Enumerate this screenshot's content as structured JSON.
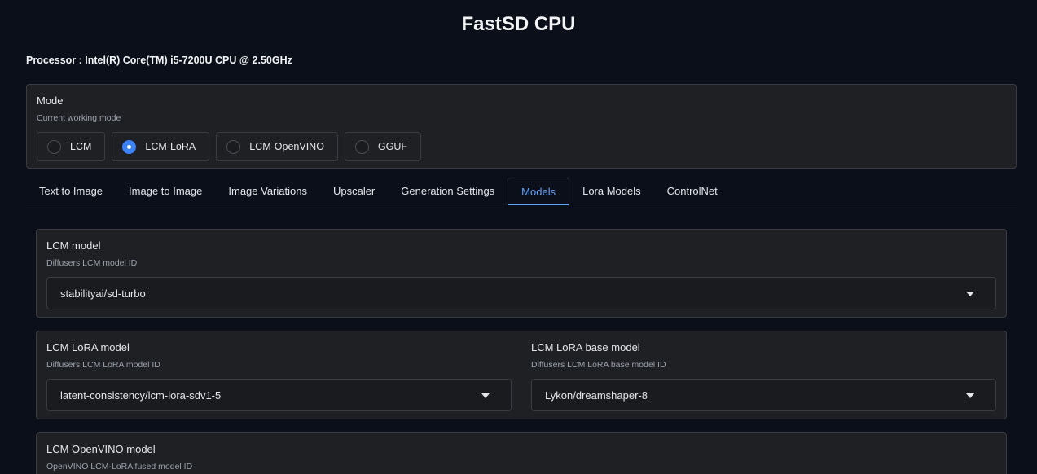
{
  "app": {
    "title": "FastSD CPU",
    "processor": "Processor : Intel(R) Core(TM) i5-7200U CPU @ 2.50GHz"
  },
  "mode": {
    "label": "Mode",
    "subtitle": "Current working mode",
    "options": [
      "LCM",
      "LCM-LoRA",
      "LCM-OpenVINO",
      "GGUF"
    ],
    "selected": "LCM-LoRA"
  },
  "tabs": [
    "Text to Image",
    "Image to Image",
    "Image Variations",
    "Upscaler",
    "Generation Settings",
    "Models",
    "Lora Models",
    "ControlNet"
  ],
  "active_tab": "Models",
  "models": {
    "lcm": {
      "label": "LCM model",
      "subtitle": "Diffusers LCM model ID",
      "value": "stabilityai/sd-turbo"
    },
    "lcm_lora": {
      "label": "LCM LoRA model",
      "subtitle": "Diffusers LCM LoRA model ID",
      "value": "latent-consistency/lcm-lora-sdv1-5"
    },
    "lcm_lora_base": {
      "label": "LCM LoRA base model",
      "subtitle": "Diffusers LCM LoRA base model ID",
      "value": "Lykon/dreamshaper-8"
    },
    "openvino": {
      "label": "LCM OpenVINO model",
      "subtitle": "OpenVINO LCM-LoRA fused model ID"
    }
  },
  "colors": {
    "background": "#0b0f19",
    "panel": "#1f2023",
    "accent": "#3b82f6",
    "active_tab": "#60a5fa"
  },
  "icons": {
    "dropdown": "chevron-down-icon",
    "radio": "radio-icon"
  }
}
